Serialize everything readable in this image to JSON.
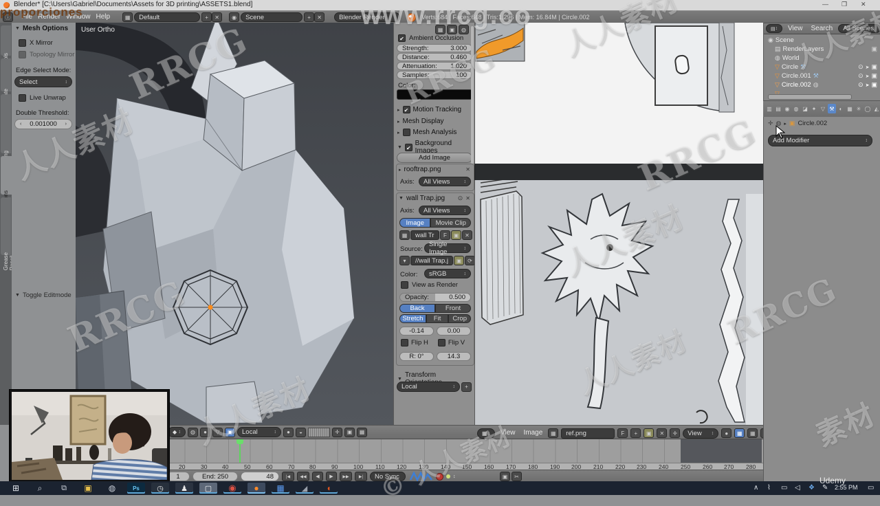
{
  "overlay": {
    "caption": "proporciones",
    "site": "www.rrcg.co",
    "udemy": "Udemy",
    "watermarks": [
      {
        "text": "RRCG",
        "style": "left:185px;top:62px;font-size:52px"
      },
      {
        "text": "人人素材",
        "style": "left:15px;top:175px;font-size:44px"
      },
      {
        "text": "RRCG",
        "style": "left:95px;top:430px;font-size:52px"
      },
      {
        "text": "人人素材",
        "style": "left:280px;top:565px;font-size:42px"
      },
      {
        "text": "人人素材",
        "style": "left:815px;top:0px;font-size:42px"
      },
      {
        "text": "RRCG",
        "style": "left:925px;top:195px;font-size:52px"
      },
      {
        "text": "人人素材",
        "style": "left:815px;top:315px;font-size:44px"
      },
      {
        "text": "RRCG",
        "style": "left:1055px;top:425px;font-size:48px"
      },
      {
        "text": "人人素材",
        "style": "left:835px;top:495px;font-size:40px"
      },
      {
        "text": "人人素材",
        "style": "left:1150px;top:25px;font-size:38px"
      },
      {
        "text": "素材",
        "style": "left:1185px;top:585px;font-size:42px"
      },
      {
        "text": "© 人人素材",
        "style": "left:545px;top:645px;font-size:36px"
      },
      {
        "text": "RRCG",
        "style": "left:585px;top:88px;font-size:40px"
      }
    ]
  },
  "titlebar": {
    "title": "Blender* [C:\\Users\\Gabriel\\Documents\\Assets for 3D printing\\ASSETS1.blend]"
  },
  "icons": {
    "min": "—",
    "max": "❐",
    "close": "✕",
    "chev_down": "▾",
    "chev_right": "▸",
    "chev_exp": "▼",
    "updown": "↕",
    "left": "‹",
    "right": "›",
    "check": "✔",
    "plus": "+",
    "x": "✕",
    "f": "F",
    "eye": "⊙",
    "pointer": "➤",
    "camera": "▣",
    "wrench": "⚒",
    "dot": "●",
    "grid": "▦",
    "folder": "▣",
    "refresh": "⟳",
    "pin": "✛",
    "sphere": "◍",
    "tri": "▽",
    "scene": "◉",
    "layers": "▤",
    "world": "◍",
    "img": "▦",
    "scissors": "✂",
    "swirl": "↻",
    "info": "ⓘ",
    "jump_start": "|◀",
    "key_prev": "◀◀",
    "play_rev": "◀",
    "play": "▶",
    "key_next": "▶▶",
    "jump_end": "▶|",
    "chev_up": "∧",
    "mic": "⌇",
    "monitor": "▭",
    "speaker": "◁",
    "tray_a": "❖",
    "tray_b": "✎",
    "notif": "▭",
    "magnet": "◒",
    "manip": "✛",
    "layerdots": "▦ ▦",
    "mode": "◆",
    "proped": "⚙"
  },
  "menubar": {
    "menus": [
      "File",
      "Render",
      "Window",
      "Help"
    ],
    "layout": "Default",
    "scene": "Scene",
    "engine": "Blender Render",
    "stats": "Verts:684 | Faces:648 | Tris:1,296 | Mem: 16.84M | Circle.002"
  },
  "toolshelf": {
    "tabs": [
      "Tools",
      "Create",
      "Shading / UVs",
      "Options",
      "Grease Pencil"
    ],
    "panel_title": "Mesh Options",
    "x_mirror": "X Mirror",
    "topology_mirror": "Topology Mirror",
    "edge_label": "Edge Select Mode:",
    "edge_value": "Select",
    "live_unwrap": "Live Unwrap",
    "threshold_label": "Double Threshold:",
    "threshold_value": "0.001000",
    "operator": "Toggle Editmode"
  },
  "viewport": {
    "label": "User Ortho"
  },
  "npanel": {
    "ao_label": "Ambient Occlusion",
    "rows": [
      {
        "label": "Strength:",
        "value": "3.000"
      },
      {
        "label": "Distance:",
        "value": "0.460"
      },
      {
        "label": "Attenuation:",
        "value": "1.020"
      },
      {
        "label": "Samples:",
        "value": "100"
      }
    ],
    "color_label": "Color:",
    "motion_tracking": "Motion Tracking",
    "mesh_display": "Mesh Display",
    "mesh_analysis": "Mesh Analysis",
    "background_images": "Background Images",
    "add_image": "Add Image",
    "img1": {
      "name": "rooftrap.png",
      "axis_label": "Axis:",
      "axis": "All Views"
    },
    "img2": {
      "name": "wall Trap.jpg",
      "axis_label": "Axis:",
      "axis": "All Views",
      "tab_image": "Image",
      "tab_clip": "Movie Clip",
      "datablock": "wall Tr",
      "source_label": "Source:",
      "source": "Single Image",
      "path": "//wall Trap.j...",
      "color_label": "Color:",
      "colorspace": "sRGB",
      "view_as_render": "View as Render",
      "opacity_label": "Opacity:",
      "opacity": "0.500",
      "back": "Back",
      "front": "Front",
      "stretch": "Stretch",
      "fit": "Fit",
      "crop": "Crop",
      "offset_x": "-0.14",
      "offset_y": "0.00",
      "flip_h": "Flip H",
      "flip_v": "Flip V",
      "rotation": "R: 0°",
      "size": "14.3"
    },
    "orientation_title": "Transform Orientations",
    "orientation_value": "Local"
  },
  "header3d": {
    "orientation": "Local"
  },
  "imgheader": {
    "menus": [
      "View",
      "Image"
    ],
    "datablock": "ref.png",
    "view": "View"
  },
  "outliner": {
    "menus": [
      "View",
      "Search"
    ],
    "scope": "All Scenes",
    "rows": [
      {
        "label": "Scene"
      },
      {
        "label": "RenderLayers"
      },
      {
        "label": "World"
      },
      {
        "label": "Circle"
      },
      {
        "label": "Circle.001"
      },
      {
        "label": "Circle.002"
      }
    ]
  },
  "properties": {
    "tabs": [
      {
        "glyph": "▥"
      },
      {
        "glyph": "▤"
      },
      {
        "glyph": "◉"
      },
      {
        "glyph": "◍"
      },
      {
        "glyph": "◪"
      },
      {
        "glyph": "✦"
      },
      {
        "glyph": "▽"
      },
      {
        "glyph": "⚒",
        "style": "background:#5b88c9;color:#fff;border-radius:2px"
      },
      {
        "glyph": "◐"
      },
      {
        "glyph": "▦"
      },
      {
        "glyph": "✳"
      },
      {
        "glyph": "◯"
      },
      {
        "glyph": "◭"
      }
    ],
    "object": "Circle.002",
    "add_modifier": "Add Modifier"
  },
  "timeline": {
    "start": "1",
    "end": "End: 250",
    "current": "48",
    "sync": "No Sync",
    "ruler": [
      {
        "n": "20",
        "style": "left:150px"
      },
      {
        "n": "30",
        "style": "left:182px"
      },
      {
        "n": "40",
        "style": "left:213px"
      },
      {
        "n": "50",
        "style": "left:245px"
      },
      {
        "n": "60",
        "style": "left:277px"
      },
      {
        "n": "70",
        "style": "left:309px"
      },
      {
        "n": "80",
        "style": "left:340px"
      },
      {
        "n": "90",
        "style": "left:372px"
      },
      {
        "n": "100",
        "style": "left:404px"
      },
      {
        "n": "110",
        "style": "left:436px"
      },
      {
        "n": "120",
        "style": "left:467px"
      },
      {
        "n": "130",
        "style": "left:499px"
      },
      {
        "n": "140",
        "style": "left:531px"
      },
      {
        "n": "150",
        "style": "left:562px"
      },
      {
        "n": "160",
        "style": "left:594px"
      },
      {
        "n": "170",
        "style": "left:626px"
      },
      {
        "n": "180",
        "style": "left:658px"
      },
      {
        "n": "190",
        "style": "left:690px"
      },
      {
        "n": "200",
        "style": "left:721px"
      },
      {
        "n": "210",
        "style": "left:753px"
      },
      {
        "n": "220",
        "style": "left:785px"
      },
      {
        "n": "230",
        "style": "left:816px"
      },
      {
        "n": "240",
        "style": "left:848px"
      },
      {
        "n": "250",
        "style": "left:880px"
      },
      {
        "n": "260",
        "style": "left:912px"
      },
      {
        "n": "270",
        "style": "left:943px"
      },
      {
        "n": "280",
        "style": "left:975px"
      }
    ]
  },
  "taskbar": {
    "time": "2:55 PM",
    "items": [
      {
        "glyph": "⊞",
        "style": "left:10px;color:#e6eaef;font-size:12px"
      },
      {
        "glyph": "⌕",
        "style": "left:45px;color:#cfd4db;font-size:12px"
      },
      {
        "glyph": "⧉",
        "style": "left:80px;color:#cfd4db;font-size:11px"
      },
      {
        "glyph": "▣",
        "style": "left:115px;color:#e9c04b;font-size:12px"
      },
      {
        "glyph": "◍",
        "style": "left:150px;color:#c7cdd6;font-size:12px"
      },
      {
        "glyph": "Ps",
        "style": "left:185px;color:#69c6f5;background:#0c2a3f;font-size:8px;font-weight:bold;box-shadow:inset 0 -2px 0 #5fa8d8"
      },
      {
        "glyph": "◷",
        "style": "left:220px;color:#e8e8e8;background:#27303c;box-shadow:inset 0 -2px 0 #5fa8d8"
      },
      {
        "glyph": "♟",
        "style": "left:255px;color:#e8e8e8;background:#2b3340;box-shadow:inset 0 -2px 0 #5fa8d8"
      },
      {
        "glyph": "▢",
        "style": "left:290px;color:#f0f2f4;background:#5d6878;box-shadow:inset 0 -2px 0 #5fa8d8"
      },
      {
        "glyph": "◉",
        "style": "left:325px;color:#dd5144;font-size:13px;box-shadow:inset 0 -2px 0 #5fa8d8"
      },
      {
        "glyph": "●",
        "style": "left:360px;color:#ff8a2a;background:#3d4a5e;font-size:12px;box-shadow:inset 0 -2px 0 #7cc0ef"
      },
      {
        "glyph": "▦",
        "style": "left:395px;color:#5b9bf0;font-size:12px;box-shadow:inset 0 -2px 0 #5fa8d8"
      },
      {
        "glyph": "◢",
        "style": "left:430px;color:#9aa1ab;font-size:11px;box-shadow:inset 0 -2px 0 #5fa8d8"
      },
      {
        "glyph": "◖",
        "style": "left:465px;color:#e0551f;font-size:12px;box-shadow:inset 0 -2px 0 #5fa8d8"
      }
    ]
  }
}
